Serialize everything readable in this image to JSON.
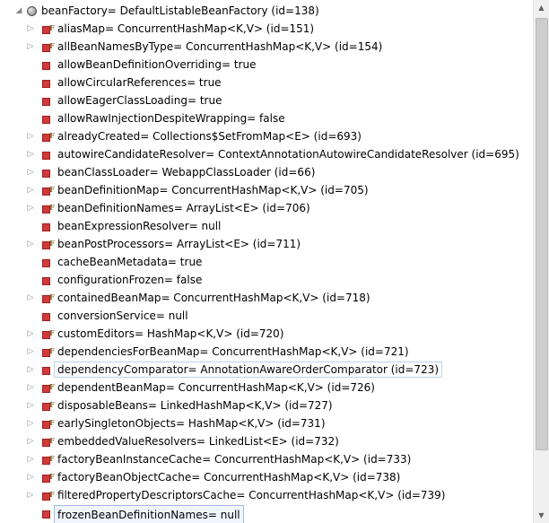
{
  "tree": {
    "root": {
      "label": "beanFactory= DefaultListableBeanFactory  (id=138)",
      "expanded": true,
      "icon": "object-icon"
    },
    "children": [
      {
        "label": "aliasMap= ConcurrentHashMap<K,V>  (id=151)",
        "expandable": true,
        "final": true
      },
      {
        "label": "allBeanNamesByType= ConcurrentHashMap<K,V>  (id=154)",
        "expandable": true,
        "final": true
      },
      {
        "label": "allowBeanDefinitionOverriding= true",
        "expandable": false,
        "final": false
      },
      {
        "label": "allowCircularReferences= true",
        "expandable": false,
        "final": false
      },
      {
        "label": "allowEagerClassLoading= true",
        "expandable": false,
        "final": false
      },
      {
        "label": "allowRawInjectionDespiteWrapping= false",
        "expandable": false,
        "final": false
      },
      {
        "label": "alreadyCreated= Collections$SetFromMap<E>  (id=693)",
        "expandable": true,
        "final": true
      },
      {
        "label": "autowireCandidateResolver= ContextAnnotationAutowireCandidateResolver  (id=695)",
        "expandable": true,
        "final": false
      },
      {
        "label": "beanClassLoader= WebappClassLoader  (id=66)",
        "expandable": true,
        "final": false
      },
      {
        "label": "beanDefinitionMap= ConcurrentHashMap<K,V>  (id=705)",
        "expandable": true,
        "final": true
      },
      {
        "label": "beanDefinitionNames= ArrayList<E>  (id=706)",
        "expandable": true,
        "final": true
      },
      {
        "label": "beanExpressionResolver= null",
        "expandable": false,
        "final": false
      },
      {
        "label": "beanPostProcessors= ArrayList<E>  (id=711)",
        "expandable": true,
        "final": true
      },
      {
        "label": "cacheBeanMetadata= true",
        "expandable": false,
        "final": false
      },
      {
        "label": "configurationFrozen= false",
        "expandable": false,
        "final": false
      },
      {
        "label": "containedBeanMap= ConcurrentHashMap<K,V>  (id=718)",
        "expandable": true,
        "final": true
      },
      {
        "label": "conversionService= null",
        "expandable": false,
        "final": false
      },
      {
        "label": "customEditors= HashMap<K,V>  (id=720)",
        "expandable": true,
        "final": true
      },
      {
        "label": "dependenciesForBeanMap= ConcurrentHashMap<K,V>  (id=721)",
        "expandable": true,
        "final": true
      },
      {
        "label": "dependencyComparator= AnnotationAwareOrderComparator  (id=723)",
        "expandable": true,
        "final": false,
        "highlighted": true
      },
      {
        "label": "dependentBeanMap= ConcurrentHashMap<K,V>  (id=726)",
        "expandable": true,
        "final": true
      },
      {
        "label": "disposableBeans= LinkedHashMap<K,V>  (id=727)",
        "expandable": true,
        "final": true
      },
      {
        "label": "earlySingletonObjects= HashMap<K,V>  (id=731)",
        "expandable": true,
        "final": true
      },
      {
        "label": "embeddedValueResolvers= LinkedList<E>  (id=732)",
        "expandable": true,
        "final": true
      },
      {
        "label": "factoryBeanInstanceCache= ConcurrentHashMap<K,V>  (id=733)",
        "expandable": true,
        "final": true
      },
      {
        "label": "factoryBeanObjectCache= ConcurrentHashMap<K,V>  (id=738)",
        "expandable": true,
        "final": true
      },
      {
        "label": "filteredPropertyDescriptorsCache= ConcurrentHashMap<K,V>  (id=739)",
        "expandable": true,
        "final": true
      },
      {
        "label": "frozenBeanDefinitionNames= null",
        "expandable": false,
        "final": false,
        "selected": true
      }
    ]
  },
  "colors": {
    "field_icon": "#d03a3a",
    "final_marker": "#806020",
    "selection_border": "#9dbbe8"
  }
}
